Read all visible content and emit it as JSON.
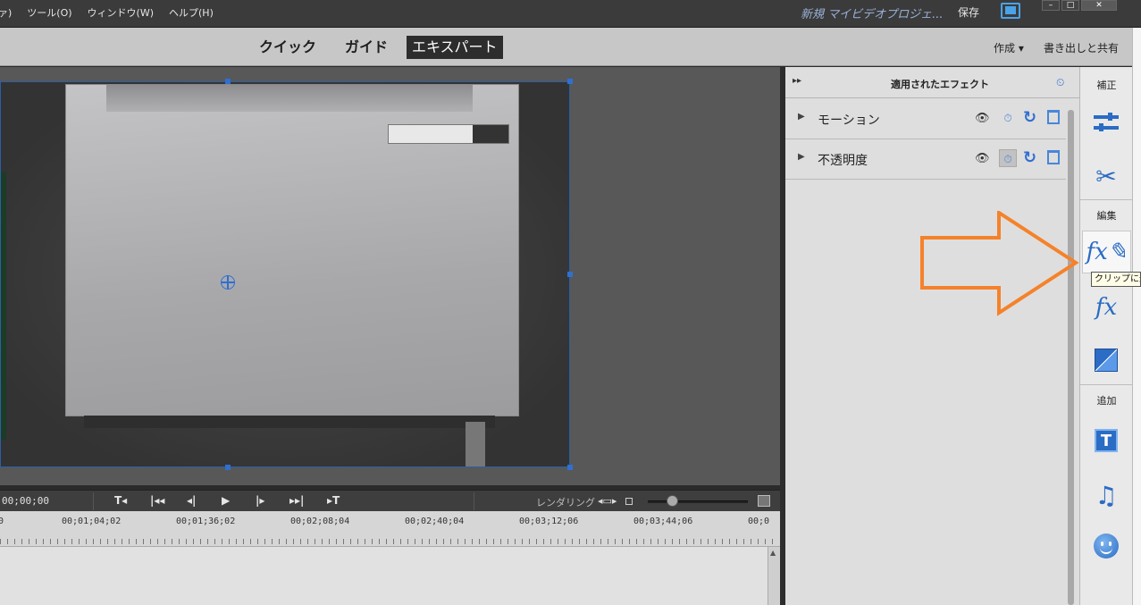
{
  "menubar": {
    "items": [
      "ァ)",
      "ツール(O)",
      "ウィンドウ(W)",
      "ヘルプ(H)"
    ],
    "project_title": "新規 マイビデオプロジェ...",
    "save_label": "保存"
  },
  "modes": {
    "tabs": [
      {
        "label": "クイック",
        "active": false
      },
      {
        "label": "ガイド",
        "active": false
      },
      {
        "label": "エキスパート",
        "active": true
      }
    ],
    "create_label": "作成 ▾",
    "export_label": "書き出しと共有"
  },
  "transport": {
    "timecode": "00;00;00",
    "controls": [
      "T◂",
      "|◂◂",
      "◂|",
      "▶",
      "|▸",
      "▸▸|",
      "▸T"
    ],
    "render_label": "レンダリング",
    "fit_icon": "◂▭▸"
  },
  "ruler": {
    "labels": [
      "0",
      "00;01;04;02",
      "00;01;36;02",
      "00;02;08;04",
      "00;02;40;04",
      "00;03;12;06",
      "00;03;44;06",
      "00;0"
    ]
  },
  "effects_panel": {
    "title": "適用されたエフェクト",
    "collapse_icon": "▸▸",
    "rows": [
      {
        "name": "モーション",
        "stopwatch_on": false
      },
      {
        "name": "不透明度",
        "stopwatch_on": true
      }
    ]
  },
  "toolstrip": {
    "section_adjust": "補正",
    "section_edit": "編集",
    "section_add": "追加",
    "tooltip": "クリップに適用",
    "icons": [
      "adjust-sliders-icon",
      "tools-icon",
      "applied-effects-fx-icon",
      "effects-fx-icon",
      "transitions-icon",
      "titles-icon",
      "music-icon",
      "graphics-smiley-icon"
    ],
    "accent_color": "#2b6cc4"
  },
  "annotation": {
    "arrow_color": "#f5822a"
  }
}
